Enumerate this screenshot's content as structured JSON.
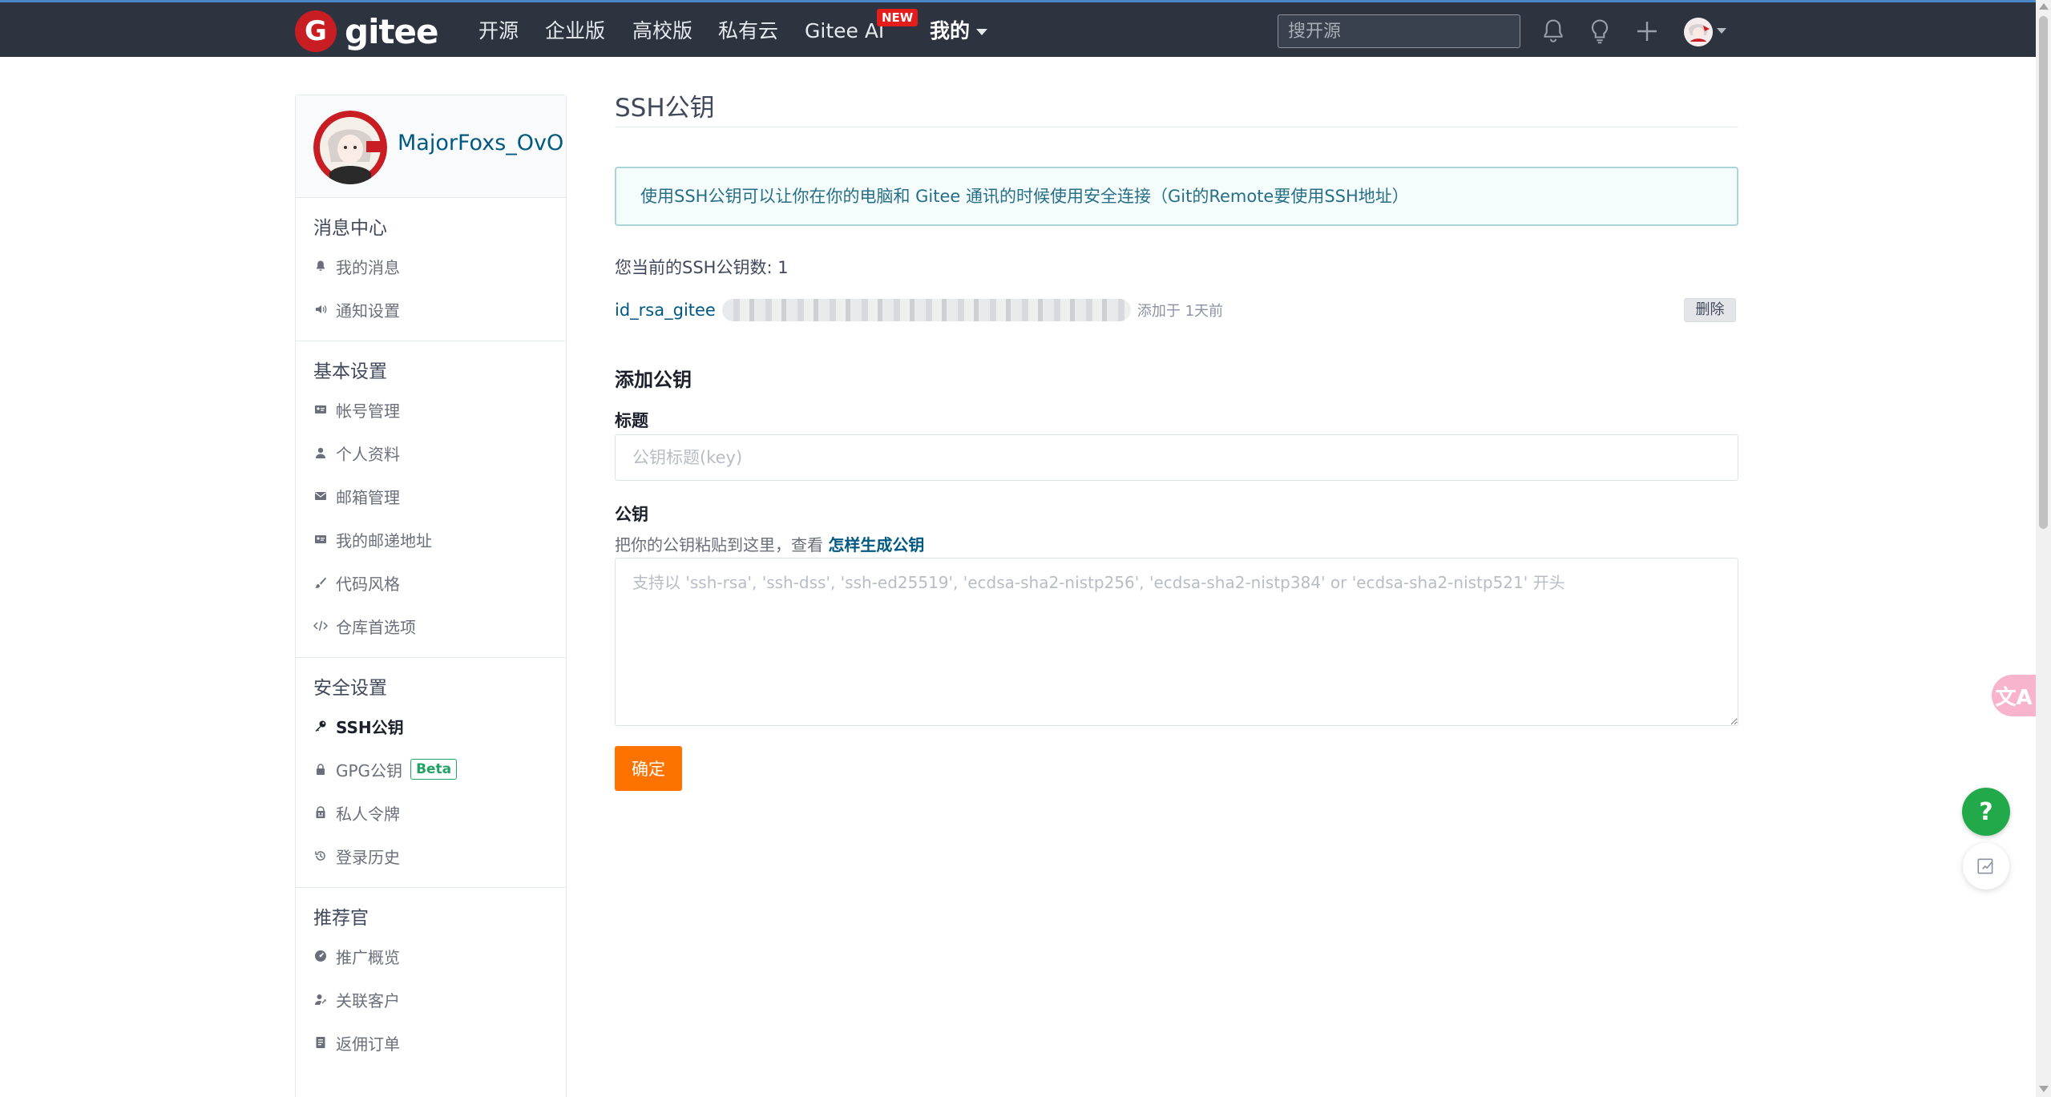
{
  "nav": {
    "logo_mark": "G",
    "logo_text": "gitee",
    "items": [
      "开源",
      "企业版",
      "高校版",
      "私有云",
      "Gitee AI",
      "我的"
    ],
    "new_badge": "NEW",
    "search_placeholder": "搜开源"
  },
  "profile": {
    "username": "MajorFoxs_OvO"
  },
  "sidebar": {
    "sections": [
      {
        "title": "消息中心",
        "items": [
          {
            "label": "我的消息",
            "icon": "bell-icon"
          },
          {
            "label": "通知设置",
            "icon": "volume-icon"
          }
        ]
      },
      {
        "title": "基本设置",
        "items": [
          {
            "label": "帐号管理",
            "icon": "id-card-icon"
          },
          {
            "label": "个人资料",
            "icon": "user-icon"
          },
          {
            "label": "邮箱管理",
            "icon": "mail-icon"
          },
          {
            "label": "我的邮递地址",
            "icon": "address-card-icon"
          },
          {
            "label": "代码风格",
            "icon": "brush-icon"
          },
          {
            "label": "仓库首选项",
            "icon": "code-icon"
          }
        ]
      },
      {
        "title": "安全设置",
        "items": [
          {
            "label": "SSH公钥",
            "icon": "key-icon",
            "active": true
          },
          {
            "label": "GPG公钥",
            "icon": "lock-icon",
            "badge": "Beta"
          },
          {
            "label": "私人令牌",
            "icon": "token-icon"
          },
          {
            "label": "登录历史",
            "icon": "history-icon"
          }
        ]
      },
      {
        "title": "推荐官",
        "items": [
          {
            "label": "推广概览",
            "icon": "dashboard-icon"
          },
          {
            "label": "关联客户",
            "icon": "user-link-icon"
          },
          {
            "label": "返佣订单",
            "icon": "order-icon"
          }
        ]
      }
    ]
  },
  "main": {
    "title": "SSH公钥",
    "info": "使用SSH公钥可以让你在你的电脑和 Gitee 通讯的时候使用安全连接（Git的Remote要使用SSH地址）",
    "key_count": "您当前的SSH公钥数: 1",
    "keys": [
      {
        "name": "id_rsa_gitee",
        "added": "添加于 1天前",
        "delete_label": "删除"
      }
    ],
    "add_title": "添加公钥",
    "title_label": "标题",
    "title_placeholder": "公钥标题(key)",
    "key_label": "公钥",
    "key_hint": "把你的公钥粘贴到这里，查看 ",
    "key_hint_link": "怎样生成公钥",
    "key_placeholder": "支持以 'ssh-rsa', 'ssh-dss', 'ssh-ed25519', 'ecdsa-sha2-nistp256', 'ecdsa-sha2-nistp384' or 'ecdsa-sha2-nistp521' 开头",
    "confirm_label": "确定"
  },
  "floating": {
    "translate": "文A",
    "help": "?"
  },
  "colors": {
    "nav_bg": "#2d3440",
    "accent": "#fe7300",
    "link": "#005980",
    "brand_red": "#c71d23",
    "help_green": "#21a94a"
  }
}
